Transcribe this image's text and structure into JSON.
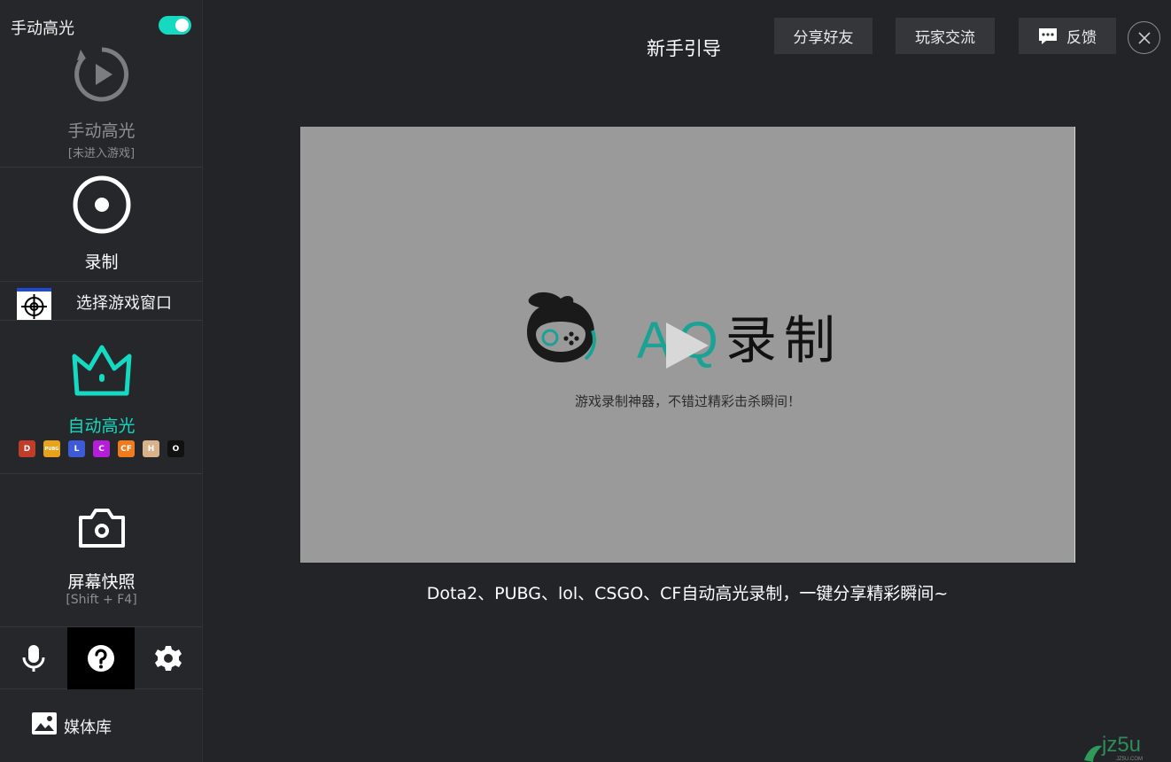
{
  "sidebar": {
    "manual_toggle_label": "手动高光",
    "manual": {
      "title": "手动高光",
      "subtitle": "[未进入游戏]"
    },
    "record": {
      "title": "录制"
    },
    "select_window": {
      "label": "选择游戏窗口"
    },
    "auto_highlight": {
      "title": "自动高光",
      "games": [
        {
          "name": "dota2",
          "glyph": "D",
          "color": "#c23c2a"
        },
        {
          "name": "pubg",
          "glyph": "PUBG",
          "color": "#e9a21b"
        },
        {
          "name": "lol",
          "glyph": "L",
          "color": "#3d5bd6"
        },
        {
          "name": "csgo",
          "glyph": "C",
          "color": "#b51dd9"
        },
        {
          "name": "cf",
          "glyph": "CF",
          "color": "#f07b1d"
        },
        {
          "name": "hero",
          "glyph": "H",
          "color": "#d9b28a"
        },
        {
          "name": "overwatch",
          "glyph": "O",
          "color": "#111111"
        }
      ]
    },
    "snapshot": {
      "title": "屏幕快照",
      "shortcut": "[Shift + F4]"
    },
    "media_library": {
      "label": "媒体库"
    }
  },
  "header": {
    "title": "新手引导",
    "share_label": "分享好友",
    "players_label": "玩家交流",
    "feedback_label": "反馈"
  },
  "video": {
    "brand_latin": "AQ",
    "brand_cjk": "录制",
    "slogan": "游戏录制神器，不错过精彩击杀瞬间！"
  },
  "caption": "Dota2、PUBG、lol、CSGO、CF自动高光录制，一键分享精彩瞬间~",
  "watermark": {
    "text": "jz5u",
    "sub": "JZ5U.COM"
  },
  "colors": {
    "accent": "#16d9c1",
    "sidebar_bg": "#25272a",
    "main_bg": "#232427"
  }
}
